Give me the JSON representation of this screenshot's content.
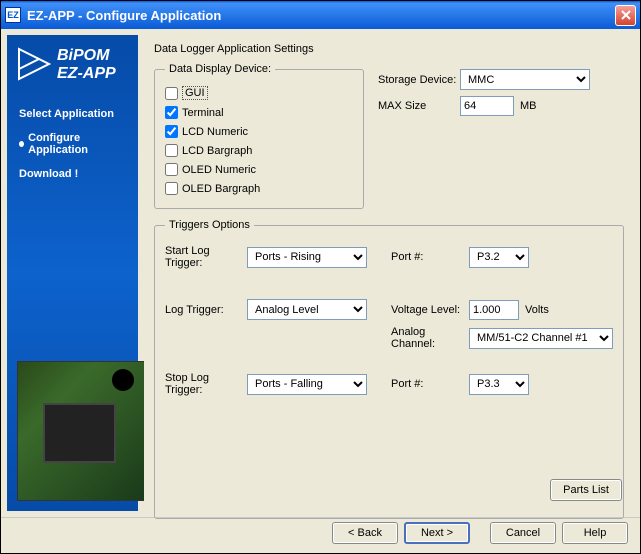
{
  "window": {
    "icon_text": "EZ",
    "title": "EZ-APP  -  Configure Application"
  },
  "sidebar": {
    "brand_line1": "BiPOM",
    "brand_line2": "EZ-APP",
    "items": [
      {
        "label": "Select Application",
        "active": false
      },
      {
        "label": "Configure Application",
        "active": true
      },
      {
        "label": "Download !",
        "active": false
      }
    ]
  },
  "main": {
    "heading": "Data Logger Application Settings",
    "display_group": {
      "legend": "Data Display Device:",
      "options": [
        {
          "label": "GUI",
          "checked": false,
          "boxed": true
        },
        {
          "label": "Terminal",
          "checked": true
        },
        {
          "label": "LCD Numeric",
          "checked": true
        },
        {
          "label": "LCD Bargraph",
          "checked": false
        },
        {
          "label": "OLED Numeric",
          "checked": false
        },
        {
          "label": "OLED Bargraph",
          "checked": false
        }
      ]
    },
    "storage": {
      "device_label": "Storage Device:",
      "device_value": "MMC",
      "max_label": "MAX Size",
      "max_value": "64",
      "max_unit": "MB"
    },
    "triggers": {
      "legend": "Triggers Options",
      "start_label": "Start Log Trigger:",
      "start_value": "Ports - Rising",
      "start_port_label": "Port #:",
      "start_port_value": "P3.2",
      "log_label": "Log Trigger:",
      "log_value": "Analog Level",
      "voltage_label": "Voltage Level:",
      "voltage_value": "1.000",
      "voltage_unit": "Volts",
      "analog_label": "Analog Channel:",
      "analog_value": "MM/51-C2 Channel #1",
      "stop_label": "Stop Log Trigger:",
      "stop_value": "Ports - Falling",
      "stop_port_label": "Port #:",
      "stop_port_value": "P3.3"
    },
    "parts_button": "Parts List"
  },
  "footer": {
    "back": "< Back",
    "next": "Next >",
    "cancel": "Cancel",
    "help": "Help"
  }
}
